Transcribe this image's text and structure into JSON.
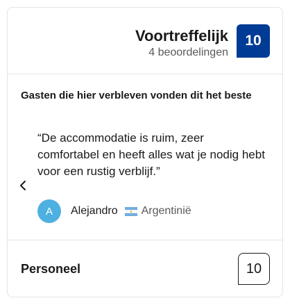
{
  "header": {
    "rating_word": "Voortreffelijk",
    "review_count": "4 beoordelingen",
    "score": "10",
    "score_color": "#003b95"
  },
  "highlights": {
    "title": "Gasten die hier verbleven vonden dit het beste",
    "quote": "“De accommodatie is ruim, zeer comfortabel en heeft alles wat je nodig hebt voor een rustig verblijf.”",
    "prev_icon": "chevron-left-icon",
    "reviewer": {
      "initial": "A",
      "name": "Alejandro",
      "avatar_color": "#4eb0e0",
      "country": "Argentinië",
      "flag_icon": "argentina-flag-icon"
    }
  },
  "category": {
    "label": "Personeel",
    "score": "10"
  }
}
